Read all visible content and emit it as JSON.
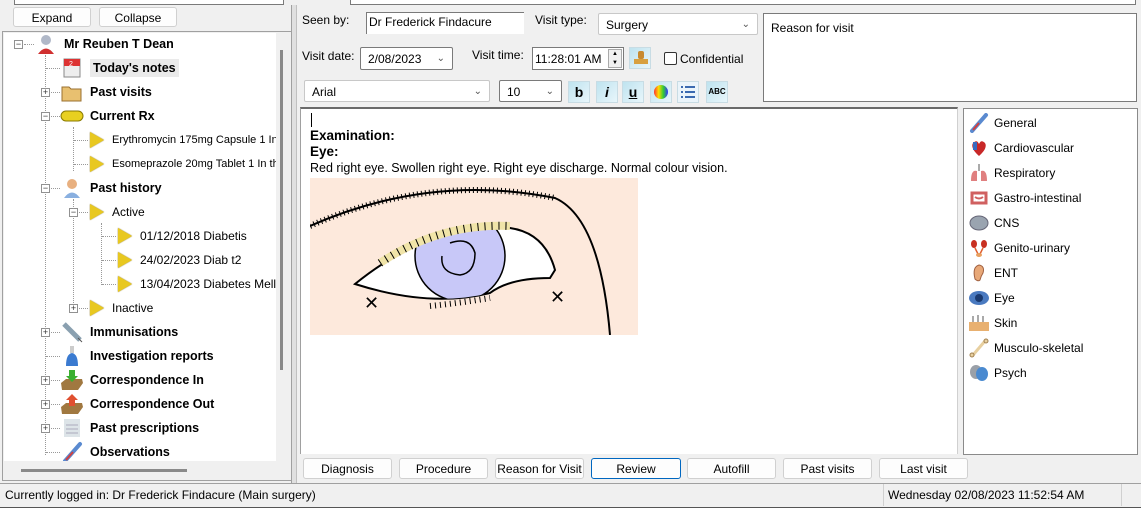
{
  "left_panel": {
    "expand_label": "Expand",
    "collapse_label": "Collapse",
    "tree": {
      "patient": "Mr Reuben T Dean",
      "todays_notes": "Today's notes",
      "past_visits": "Past visits",
      "current_rx": "Current Rx",
      "rx_items": [
        "Erythromycin 175mg Capsule 1 In",
        "Esomeprazole 20mg Tablet 1 In th"
      ],
      "past_history": "Past history",
      "active": "Active",
      "active_items": [
        "01/12/2018  Diabetis",
        "24/02/2023  Diab t2",
        "13/04/2023  Diabetes Mell."
      ],
      "inactive": "Inactive",
      "immunisations": "Immunisations",
      "investigation_reports": "Investigation reports",
      "correspondence_in": "Correspondence In",
      "correspondence_out": "Correspondence Out",
      "past_prescriptions": "Past prescriptions",
      "observations": "Observations"
    }
  },
  "visit": {
    "seen_by_label": "Seen by:",
    "seen_by_value": "Dr Frederick Findacure",
    "visit_type_label": "Visit type:",
    "visit_type_value": "Surgery",
    "visit_date_label": "Visit date:",
    "visit_date_value": "2/08/2023",
    "visit_time_label": "Visit time:",
    "visit_time_value": "11:28:01 AM",
    "confidential_label": "Confidential",
    "confidential_checked": false,
    "reason_placeholder": "Reason for visit"
  },
  "format_toolbar": {
    "font_value": "Arial",
    "size_value": "10",
    "bold_glyph": "b",
    "italic_glyph": "i",
    "underline_glyph": "u",
    "spell_glyph": "ABC"
  },
  "notes": {
    "heading1": "Examination:",
    "heading2": "Eye:",
    "body": "Red right eye. Swollen right  eye. Right eye discharge. Normal colour vision."
  },
  "systems": [
    {
      "label": "General",
      "icon": "thermometer-icon"
    },
    {
      "label": "Cardiovascular",
      "icon": "heart-icon"
    },
    {
      "label": "Respiratory",
      "icon": "lungs-icon"
    },
    {
      "label": "Gastro-intestinal",
      "icon": "intestine-icon"
    },
    {
      "label": "CNS",
      "icon": "brain-icon"
    },
    {
      "label": "Genito-urinary",
      "icon": "kidney-icon"
    },
    {
      "label": "ENT",
      "icon": "ear-icon"
    },
    {
      "label": "Eye",
      "icon": "eye-icon"
    },
    {
      "label": "Skin",
      "icon": "skin-icon"
    },
    {
      "label": "Musculo-skeletal",
      "icon": "bone-icon"
    },
    {
      "label": "Psych",
      "icon": "masks-icon"
    }
  ],
  "bottom_buttons": [
    "Diagnosis",
    "Procedure",
    "Reason for Visit",
    "Review",
    "Autofill",
    "Past visits",
    "Last visit"
  ],
  "status": {
    "logged_in": "Currently logged in:  Dr Frederick Findacure (Main surgery)",
    "datetime": "Wednesday 02/08/2023 11:52:54 AM"
  }
}
